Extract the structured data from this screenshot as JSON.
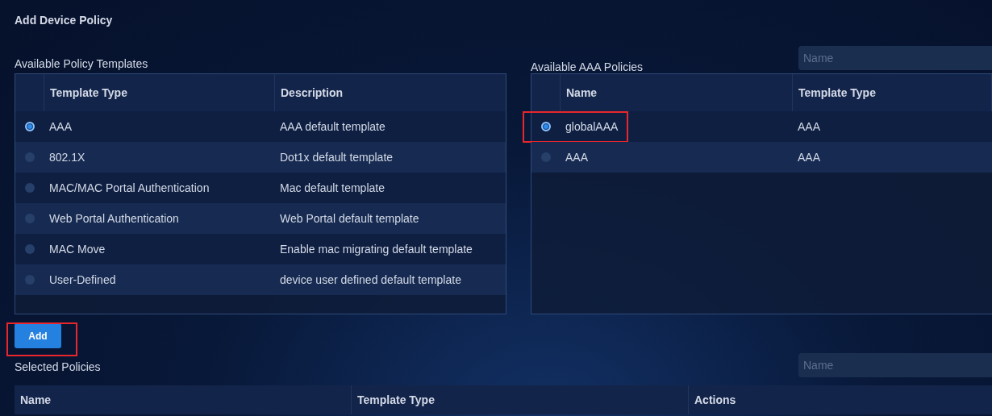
{
  "title": "Add Device Policy",
  "templates": {
    "label": "Available Policy Templates",
    "columns": [
      "Template Type",
      "Description"
    ],
    "rows": [
      {
        "type": "AAA",
        "description": "AAA default template",
        "selected": true
      },
      {
        "type": "802.1X",
        "description": "Dot1x default template",
        "selected": false
      },
      {
        "type": "MAC/MAC Portal Authentication",
        "description": "Mac default template",
        "selected": false
      },
      {
        "type": "Web Portal Authentication",
        "description": "Web Portal default template",
        "selected": false
      },
      {
        "type": "MAC Move",
        "description": "Enable mac migrating default template",
        "selected": false
      },
      {
        "type": "User-Defined",
        "description": "device user defined default template",
        "selected": false
      }
    ]
  },
  "aaa": {
    "label": "Available AAA Policies",
    "search": {
      "placeholder": "Name"
    },
    "columns": [
      "Name",
      "Template Type"
    ],
    "rows": [
      {
        "name": "globalAAA",
        "type": "AAA",
        "selected": true,
        "highlighted": true
      },
      {
        "name": "AAA",
        "type": "AAA",
        "selected": false,
        "highlighted": false
      }
    ]
  },
  "add_button": {
    "label": "Add",
    "highlighted": true
  },
  "selected_policies": {
    "label": "Selected Policies",
    "search": {
      "placeholder": "Name"
    },
    "columns": [
      "Name",
      "Template Type",
      "Actions"
    ]
  }
}
